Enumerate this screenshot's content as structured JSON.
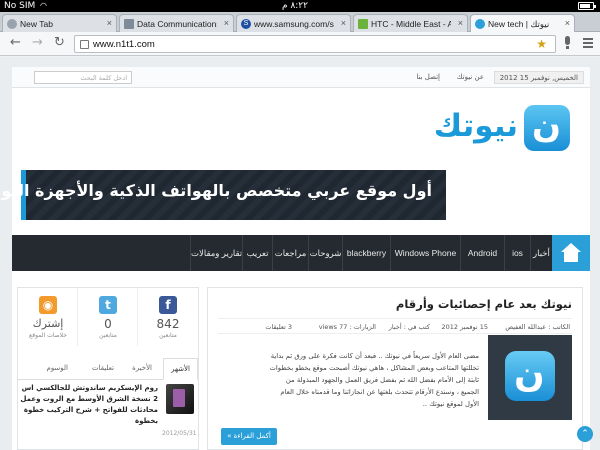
{
  "status_bar": {
    "carrier": "No SIM",
    "time": "٨:٢٢ م",
    "battery_level": 0.85
  },
  "tabs": [
    {
      "label": "New Tab",
      "favicon": "chrome",
      "active": false
    },
    {
      "label": "Data Communications - N",
      "favicon": "doc",
      "active": false
    },
    {
      "label": "www.samsung.com/sa/co",
      "favicon": "S",
      "active": false
    },
    {
      "label": "HTC - Middle East - Arabi",
      "favicon": "htc",
      "active": false
    },
    {
      "label": "New tech | نيوتك",
      "favicon": "n1t1",
      "active": true
    }
  ],
  "toolbar": {
    "url": "www.n1t1.com",
    "back_icon": "back-arrow-icon",
    "forward_icon": "forward-arrow-icon",
    "reload_icon": "reload-icon"
  },
  "site": {
    "topbar": {
      "date": "الخميس, نوفمبر 15 2012",
      "about": "عن نيوتك",
      "contact": "إتصل بنا",
      "search_placeholder": "ادخل كلمة البحث"
    },
    "logo_text": "نيوتك",
    "logo_letter": "ن",
    "banner_text": "أول موقع عربي متخصص بالهواتف الذكية والأجهزة اللوحية",
    "nav": [
      "أخبار",
      "ios",
      "Android",
      "Windows Phone",
      "blackberry",
      "شروحات",
      "مراجعات",
      "تعريب",
      "تقارير ومقالات"
    ],
    "social": [
      {
        "count": "842",
        "label": "متابعين",
        "icon": "facebook-icon",
        "glyph": "f",
        "color": "#3b5998"
      },
      {
        "count": "0",
        "label": "متابعين",
        "icon": "twitter-icon",
        "glyph": "t",
        "color": "#4fa8e0"
      },
      {
        "count": "إشترك",
        "label": "خلاصات الموقع",
        "icon": "rss-icon",
        "glyph": "◉",
        "color": "#f39a2c"
      }
    ],
    "side_tabs": [
      "الأشهر",
      "الأخيرة",
      "تعليقات",
      "الوسوم"
    ],
    "side_post": {
      "title": "روم الإيسكريم ساندوتش للجالكسي اس 2 نسخة الشرق الأوسط مع الروت وعمل محادثات للفواتح + شرح التركيب خطوة بخطوة",
      "date": "2012/05/31"
    },
    "article": {
      "title": "نيوتك بعد عام إحصائيات وأرقام",
      "meta": {
        "author": "الكاتب : عبدالله الغفيص",
        "date": "15 نوفمبر 2012",
        "category": "كتب في : أخبار",
        "views": "الزيارات : 77 views",
        "comments": "3 تعليقات"
      },
      "excerpt": "مضى العام الأول سريعاً في نيوتك .. فبعد أن كانت فكرة على ورق ثم بداية تخللتها المتاعب وبعض المشاكل ، هاهي نيوتك أصبحت موقع يخطو بخطوات ثابتة إلى الأمام بفضل الله ثم بفضل فريق العمل والجهود المبذولة من الجميع ، وسندع الأرقام تتحدث بلغتها عن انجازاتنا وما قدمناه خلال العام الأول لموقع نيوتك ..",
      "read_more": "أكمل القراءة »"
    }
  }
}
